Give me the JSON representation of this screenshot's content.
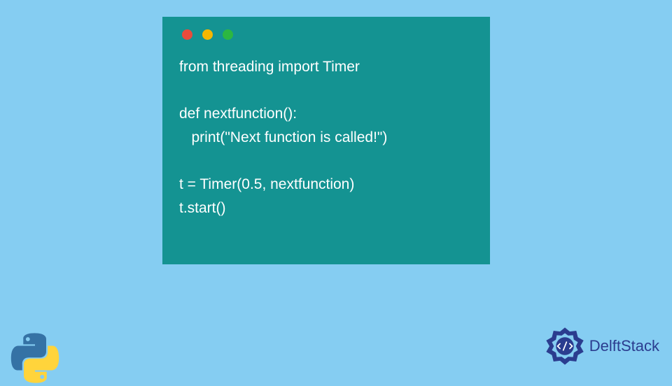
{
  "code": {
    "lines": [
      "from threading import Timer",
      "",
      "def nextfunction():",
      "   print(\"Next function is called!\")",
      "",
      "t = Timer(0.5, nextfunction)",
      "t.start()"
    ]
  },
  "branding": {
    "delftstack_label": "DelftStack"
  },
  "colors": {
    "background": "#85cdf2",
    "window": "#149392",
    "code_text": "#ffffff",
    "brand_text": "#2b3d8f",
    "dot_red": "#e94b3c",
    "dot_yellow": "#f5b700",
    "dot_green": "#2cb742"
  },
  "language_icon": "python"
}
